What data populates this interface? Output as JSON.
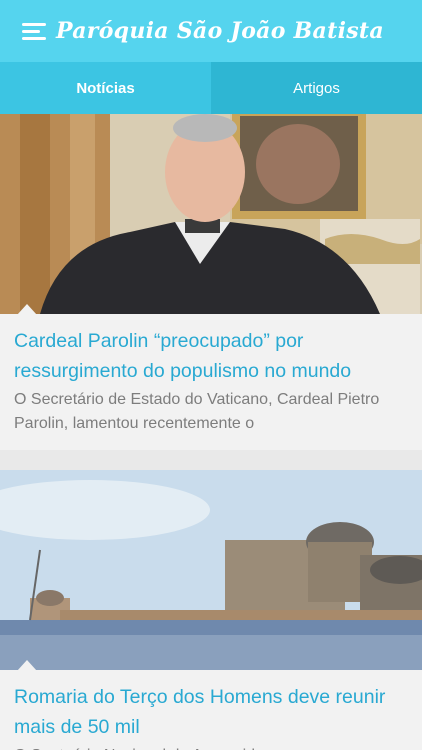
{
  "app": {
    "title": "Paróquia São João Batista"
  },
  "tabs": [
    {
      "label": "Notícias",
      "active": true
    },
    {
      "label": "Artigos",
      "active": false
    }
  ],
  "articles": [
    {
      "title": "Cardeal Parolin “preocupado” por ressurgimento do populismo no mundo",
      "excerpt": "O Secretário de Estado do Vaticano, Cardeal Pietro Parolin, lamentou recentemente o"
    },
    {
      "title": "Romaria do Terço dos Homens deve reunir mais de 50 mil",
      "excerpt": "O Santuário Nacional de Aparecida espera"
    }
  ],
  "colors": {
    "appbar": "#55d4ee",
    "tab_active": "#3cc5e3",
    "tab_inactive": "#2eb6d3",
    "title_text": "#29a9d2",
    "excerpt_text": "#7d7d7d",
    "background": "#e9e9e9"
  },
  "icons": {
    "menu": "menu-list-icon"
  }
}
